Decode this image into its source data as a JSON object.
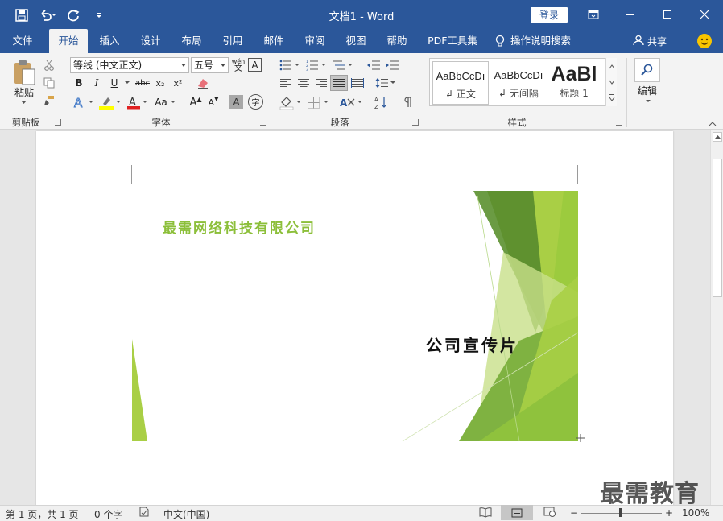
{
  "titlebar": {
    "doc_name": "文档1",
    "separator": "-",
    "app_name": "Word",
    "login_label": "登录"
  },
  "tabs": [
    "文件",
    "开始",
    "插入",
    "设计",
    "布局",
    "引用",
    "邮件",
    "审阅",
    "视图",
    "帮助",
    "PDF工具集"
  ],
  "active_tab": "开始",
  "tell_me": "操作说明搜索",
  "share_label": "共享",
  "ribbon": {
    "clipboard": {
      "paste_label": "粘贴",
      "group_label": "剪贴板"
    },
    "font": {
      "font_name": "等线 (中文正文)",
      "font_size": "五号",
      "phonetic_top": "wén",
      "phonetic_bottom": "文",
      "group_label": "字体",
      "bold": "B",
      "italic": "I",
      "underline": "U",
      "strike": "abc",
      "subscript": "x₂",
      "superscript": "x²",
      "grow": "A",
      "shrink": "A",
      "case": "Aa",
      "clear_char": "A",
      "enclose": "字"
    },
    "paragraph": {
      "group_label": "段落"
    },
    "styles": {
      "group_label": "样式",
      "items": [
        {
          "sample": "AaBbCcDı",
          "name": "正文"
        },
        {
          "sample": "AaBbCcDı",
          "name": "无间隔"
        },
        {
          "sample": "AaBl",
          "name": "标题 1"
        }
      ]
    },
    "editing": {
      "label": "编辑"
    }
  },
  "document": {
    "company": "最需网络科技有限公司",
    "promo": "公司宣传片"
  },
  "watermark": "最需教育",
  "statusbar": {
    "page": "第 1 页，共 1 页",
    "words": "0 个字",
    "language": "中文(中国)",
    "zoom_minus": "−",
    "zoom_plus": "+",
    "zoom": "100%"
  },
  "colors": {
    "title_blue": "#2b579a",
    "green_light": "#a9cf45",
    "green_dark": "#5d8f2b",
    "font_red": "#e02020",
    "highlight_yellow": "#ffff00"
  }
}
